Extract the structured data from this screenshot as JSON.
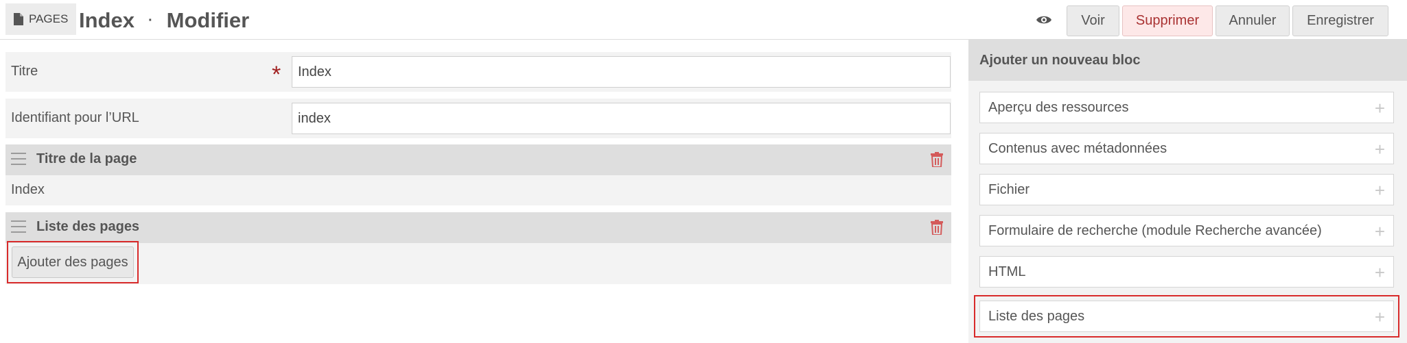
{
  "header": {
    "section_badge": "PAGES",
    "title": "Index",
    "separator": "·",
    "subtitle": "Modifier",
    "buttons": {
      "view": "Voir",
      "delete": "Supprimer",
      "cancel": "Annuler",
      "save": "Enregistrer"
    },
    "icons": {
      "badge": "file-icon",
      "preview": "eye-icon"
    }
  },
  "form": {
    "title_label": "Titre",
    "title_required_marker": "*",
    "title_value": "Index",
    "slug_label": "Identifiant pour l’URL",
    "slug_value": "index"
  },
  "blocks": [
    {
      "title": "Titre de la page",
      "content": "Index"
    },
    {
      "title": "Liste des pages",
      "action": "Ajouter des pages"
    }
  ],
  "sidebar": {
    "title": "Ajouter un nouveau bloc",
    "items": [
      {
        "label": "Aperçu des ressources",
        "icon": "+"
      },
      {
        "label": "Contenus avec métadonnées",
        "icon": "+"
      },
      {
        "label": "Fichier",
        "icon": "+"
      },
      {
        "label": "Formulaire de recherche (module Recherche avancée)",
        "icon": "+"
      },
      {
        "label": "HTML",
        "icon": "+"
      },
      {
        "label": "Liste des pages",
        "icon": "+"
      }
    ]
  },
  "colors": {
    "highlight": "#d82a2a",
    "danger_text": "#a93232",
    "danger_bg": "#fde8e8",
    "trash": "#d45b5b"
  }
}
